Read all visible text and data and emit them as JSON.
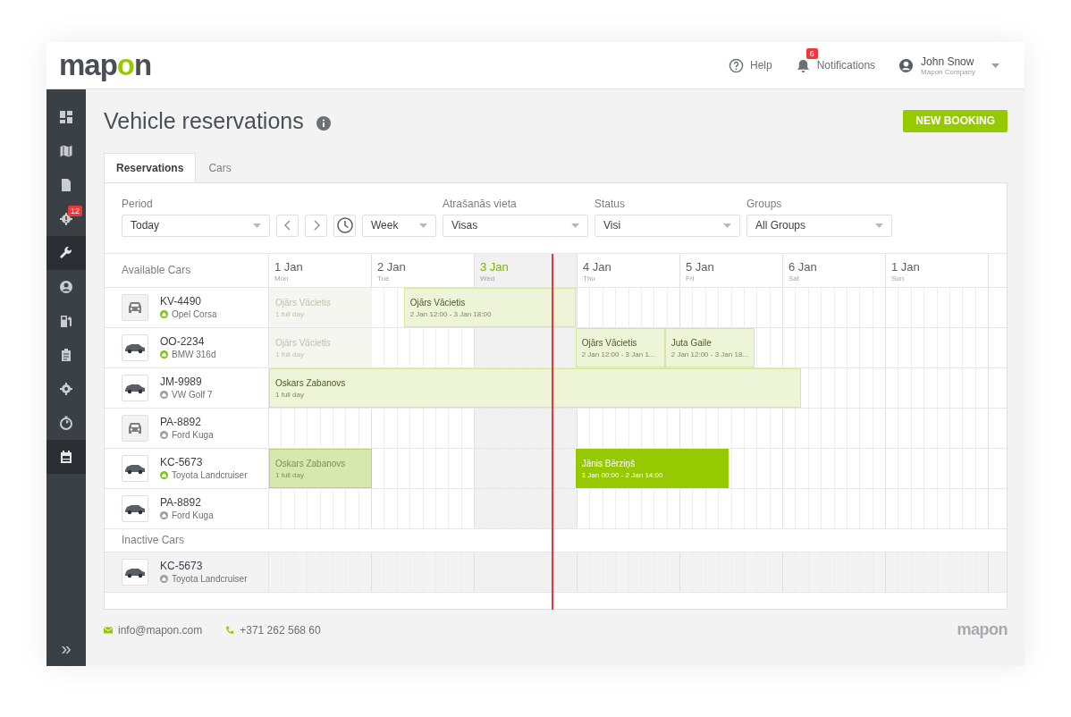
{
  "header": {
    "logo": {
      "before": "map",
      "accent": "o",
      "after": "n"
    },
    "help": "Help",
    "notifications": {
      "label": "Notifications",
      "badge": "6"
    },
    "user": {
      "name": "John Snow",
      "company": "Mapon Company"
    }
  },
  "sidebar": {
    "items": [
      {
        "selected": false
      },
      {
        "selected": false
      },
      {
        "selected": false
      },
      {
        "selected": false,
        "badge": "12"
      },
      {
        "selected": true
      },
      {
        "selected": false
      },
      {
        "selected": false
      },
      {
        "selected": false
      },
      {
        "selected": false
      },
      {
        "selected": false
      },
      {
        "selected": true
      }
    ],
    "expand": "»"
  },
  "page": {
    "title": "Vehicle reservations",
    "new_booking": "NEW BOOKING"
  },
  "tabs": [
    {
      "label": "Reservations",
      "selected": true
    },
    {
      "label": "Cars",
      "selected": false
    }
  ],
  "filters": {
    "period": {
      "label": "Period",
      "value": "Today"
    },
    "range": {
      "value": "Week"
    },
    "location": {
      "label": "Atrašanās vieta",
      "value": "Visas"
    },
    "status": {
      "label": "Status",
      "value": "Visi"
    },
    "groups": {
      "label": "Groups",
      "value": "All Groups"
    }
  },
  "schedule": {
    "available_label": "Available Cars",
    "days": [
      {
        "date": "1 Jan",
        "weekday": "Mon",
        "today": false
      },
      {
        "date": "2 Jan",
        "weekday": "Tue",
        "today": false
      },
      {
        "date": "3 Jan",
        "weekday": "Wed",
        "today": true
      },
      {
        "date": "4 Jan",
        "weekday": "Thu",
        "today": false
      },
      {
        "date": "5 Jan",
        "weekday": "Fri",
        "today": false
      },
      {
        "date": "6 Jan",
        "weekday": "Sat",
        "today": false
      },
      {
        "date": "1 Jan",
        "weekday": "Sun",
        "today": false
      }
    ],
    "cars": [
      {
        "plate": "KV-4490",
        "model": "Opel Corsa",
        "kind": "placeholder",
        "active": true,
        "bookings": [
          {
            "kind": "past",
            "name": "Ojārs Vācietis",
            "time": "1 full day"
          },
          {
            "kind": "planned",
            "name": "Ojārs Vācietis",
            "time": "2 Jan 12:00 - 3 Jan 18:00"
          }
        ]
      },
      {
        "plate": "OO-2234",
        "model": "BMW 316d",
        "kind": "photo",
        "active": true,
        "bookings": [
          {
            "kind": "past",
            "name": "Ojārs Vācietis",
            "time": "1 full day"
          },
          {
            "kind": "planned",
            "name": "Ojārs Vācietis",
            "time": "2 Jan 12:00 - 3 Jan 1..."
          },
          {
            "kind": "planned",
            "name": "Juta Gaile",
            "time": "2 Jan 12:00 - 3 Jan 18..."
          }
        ]
      },
      {
        "plate": "JM-9989",
        "model": "VW Golf 7",
        "kind": "photo",
        "active": false,
        "bookings": [
          {
            "kind": "planned",
            "name": "Oskars Zabanovs",
            "time": "1 full day"
          }
        ]
      },
      {
        "plate": "PA-8892",
        "model": "Ford Kuga",
        "kind": "placeholder",
        "active": false
      },
      {
        "plate": "KC-5673",
        "model": "Toyota Landcruiser",
        "kind": "photo",
        "active": true,
        "bookings": [
          {
            "kind": "past-assigned",
            "name": "Oskars Zabanovs",
            "time": "1 full day"
          },
          {
            "kind": "confirmed",
            "name": "Jānis Bērziņš",
            "time": "1 Jan 00:00 - 2 Jan 14:00"
          }
        ]
      },
      {
        "plate": "PA-8892",
        "model": "Ford Kuga",
        "kind": "photo",
        "active": false
      }
    ],
    "inactive_label": "Inactive Cars",
    "inactive_cars": [
      {
        "plate": "KC-5673",
        "model": "Toyota Landcruiser",
        "kind": "photo",
        "active": false
      }
    ]
  },
  "footer": {
    "email": "info@mapon.com",
    "phone": "+371 262 568 60",
    "logo": {
      "before": "map",
      "accent": "o",
      "after": "n"
    }
  }
}
